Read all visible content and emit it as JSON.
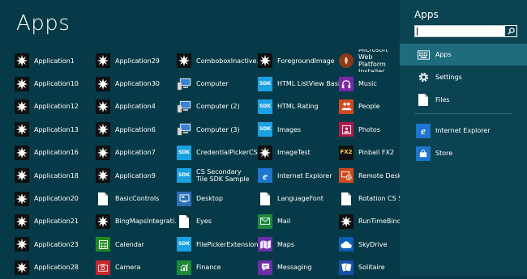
{
  "page_title": "Apps",
  "apps": [
    {
      "label": "Application1",
      "icon": "starburst-icon"
    },
    {
      "label": "Application10",
      "icon": "starburst-icon"
    },
    {
      "label": "Application12",
      "icon": "starburst-icon"
    },
    {
      "label": "Application13",
      "icon": "starburst-icon"
    },
    {
      "label": "Application16",
      "icon": "starburst-icon"
    },
    {
      "label": "Application18",
      "icon": "starburst-icon"
    },
    {
      "label": "Application20",
      "icon": "starburst-icon"
    },
    {
      "label": "Application21",
      "icon": "starburst-icon"
    },
    {
      "label": "Application23",
      "icon": "starburst-icon"
    },
    {
      "label": "Application28",
      "icon": "starburst-icon"
    },
    {
      "label": "Application29",
      "icon": "starburst-icon"
    },
    {
      "label": "Application30",
      "icon": "starburst-icon"
    },
    {
      "label": "Application4",
      "icon": "starburst-icon"
    },
    {
      "label": "Application6",
      "icon": "starburst-icon"
    },
    {
      "label": "Application7",
      "icon": "starburst-icon"
    },
    {
      "label": "Application9",
      "icon": "starburst-icon"
    },
    {
      "label": "BasicControls",
      "icon": "document-icon"
    },
    {
      "label": "BingMapsIntegrati...",
      "icon": "starburst-icon"
    },
    {
      "label": "Calendar",
      "icon": "calendar-icon"
    },
    {
      "label": "Camera",
      "icon": "camera-icon"
    },
    {
      "label": "ComboboxInactive...",
      "icon": "starburst-icon"
    },
    {
      "label": "Computer",
      "icon": "computer-icon"
    },
    {
      "label": "Computer (2)",
      "icon": "computer-icon"
    },
    {
      "label": "Computer (3)",
      "icon": "computer-icon"
    },
    {
      "label": "CredentialPickerCS",
      "icon": "sdk-icon"
    },
    {
      "label": "CS Secondary Tile SDK Sample",
      "icon": "sdk-icon",
      "two_line": true
    },
    {
      "label": "Desktop",
      "icon": "desktop-icon"
    },
    {
      "label": "Eyes",
      "icon": "document-icon"
    },
    {
      "label": "FilePickerExtension...",
      "icon": "sdk-icon"
    },
    {
      "label": "Finance",
      "icon": "finance-icon"
    },
    {
      "label": "ForegroundImage",
      "icon": "starburst-icon"
    },
    {
      "label": "HTML ListView Basic",
      "icon": "sdk-icon"
    },
    {
      "label": "HTML Rating",
      "icon": "sdk-icon"
    },
    {
      "label": "Images",
      "icon": "sdk-icon"
    },
    {
      "label": "ImageTest",
      "icon": "starburst-icon"
    },
    {
      "label": "Internet Explorer",
      "icon": "internet-explorer-icon"
    },
    {
      "label": "LanguageFont",
      "icon": "document-icon"
    },
    {
      "label": "Mail",
      "icon": "mail-icon"
    },
    {
      "label": "Maps",
      "icon": "maps-icon"
    },
    {
      "label": "Messaging",
      "icon": "messaging-icon"
    },
    {
      "label": "Microsoft Web Platform Installer",
      "icon": "web-platform-icon",
      "two_line": true
    },
    {
      "label": "Music",
      "icon": "headphones-icon"
    },
    {
      "label": "People",
      "icon": "people-icon"
    },
    {
      "label": "Photos",
      "icon": "photos-icon"
    },
    {
      "label": "Pinball FX2",
      "icon": "pinball-icon"
    },
    {
      "label": "Remote Desktop",
      "icon": "remote-desktop-icon"
    },
    {
      "label": "Rotation CS Samp",
      "icon": "document-icon"
    },
    {
      "label": "RunTimeBinding",
      "icon": "starburst-icon"
    },
    {
      "label": "SkyDrive",
      "icon": "cloud-icon"
    },
    {
      "label": "Solitaire",
      "icon": "cards-icon"
    }
  ],
  "sdk_text": "SDK",
  "search_pane": {
    "title": "Apps",
    "search_value": "",
    "items": [
      {
        "label": "Apps",
        "icon": "keyboard-icon",
        "selected": true
      },
      {
        "label": "Settings",
        "icon": "gear-icon",
        "selected": false
      },
      {
        "label": "Files",
        "icon": "file-icon",
        "selected": false
      },
      {
        "label": "Internet Explorer",
        "icon": "internet-explorer-icon",
        "selected": false
      },
      {
        "label": "Store",
        "icon": "store-icon",
        "selected": false
      }
    ]
  }
}
